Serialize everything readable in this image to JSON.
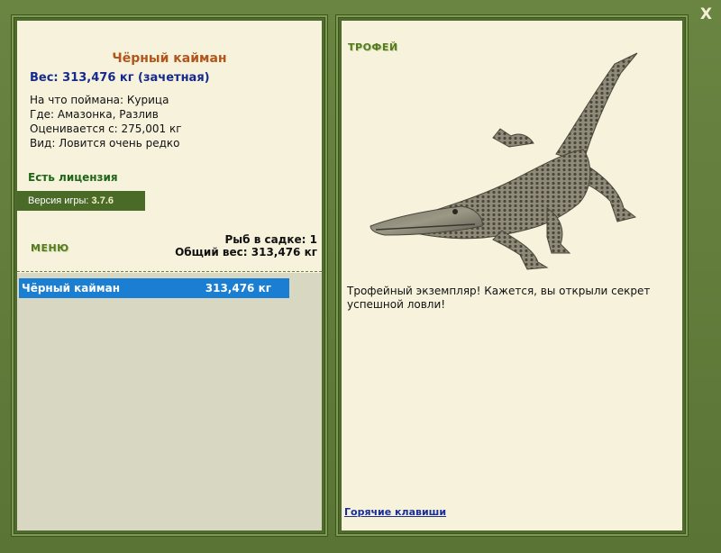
{
  "window": {
    "close_label": "X"
  },
  "fish": {
    "name": "Чёрный кайман",
    "weight_line": "Вес: 313,476 кг (зачетная)",
    "caught_on": "На что поймана: Курица",
    "where": "Где: Амазонка, Разлив",
    "valued_from": "Оценивается с: 275,001 кг",
    "kind": "Вид: Ловится очень редко"
  },
  "license": "Есть лицензия",
  "version": {
    "label": "Версия игры:",
    "value": "3.7.6"
  },
  "menu_label": "МЕНЮ",
  "stats": {
    "fish_count": "Рыб в садке: 1",
    "total_weight": "Общий вес: 313,476 кг"
  },
  "catch_list": [
    {
      "name": "Чёрный кайман",
      "weight": "313,476 кг"
    }
  ],
  "trophy": {
    "title": "ТРОФЕЙ",
    "description": "Трофейный экземпляр! Кажется, вы открыли секрет успешной ловли!",
    "image_icon": "black-caiman-image"
  },
  "hotkeys_link": "Горячие клавиши",
  "colors": {
    "frame": "#5f7a3a",
    "panel_bg": "#f6f2dc",
    "title": "#b2561c",
    "weight": "#152a8c",
    "selected_row": "#1a7ed2"
  }
}
